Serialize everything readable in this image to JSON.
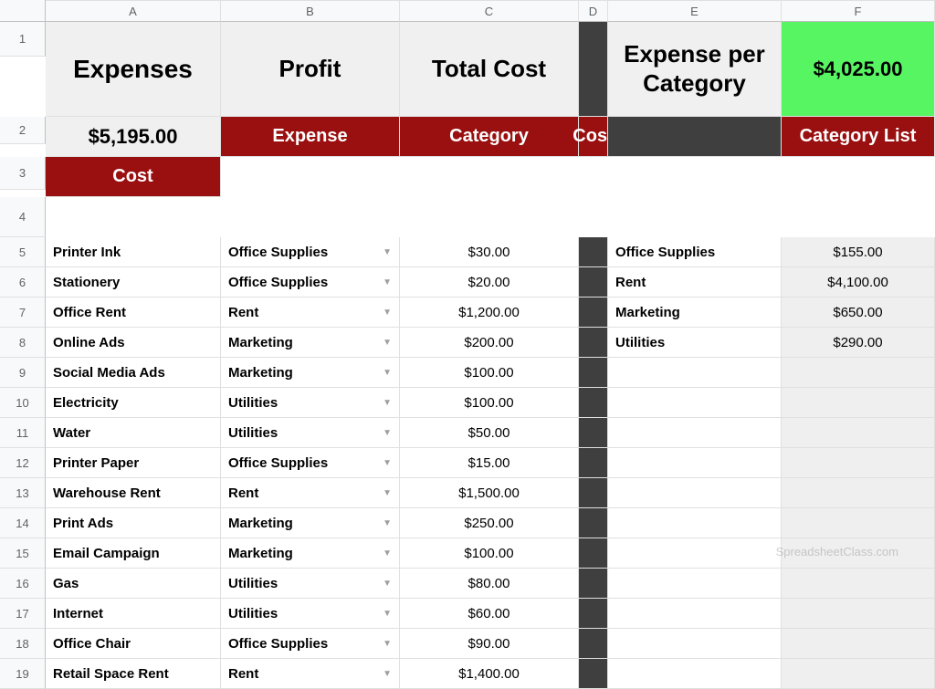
{
  "columns": [
    "A",
    "B",
    "C",
    "D",
    "E",
    "F"
  ],
  "titles": {
    "expenses": "Expenses",
    "profit": "Profit",
    "totalCost": "Total Cost",
    "expensePerCategory": "Expense per Category"
  },
  "summary": {
    "profitValue": "$4,025.00",
    "totalCostValue": "$5,195.00"
  },
  "headers": {
    "expense": "Expense",
    "category": "Category",
    "cost": "Cost",
    "categoryList": "Category List",
    "cost2": "Cost"
  },
  "rows": [
    {
      "n": "5",
      "expense": "Printer Ink",
      "category": "Office Supplies",
      "cost": "$30.00",
      "catList": "Office Supplies",
      "catCost": "$155.00"
    },
    {
      "n": "6",
      "expense": "Stationery",
      "category": "Office Supplies",
      "cost": "$20.00",
      "catList": "Rent",
      "catCost": "$4,100.00"
    },
    {
      "n": "7",
      "expense": "Office Rent",
      "category": "Rent",
      "cost": "$1,200.00",
      "catList": "Marketing",
      "catCost": "$650.00"
    },
    {
      "n": "8",
      "expense": "Online Ads",
      "category": "Marketing",
      "cost": "$200.00",
      "catList": "Utilities",
      "catCost": "$290.00"
    },
    {
      "n": "9",
      "expense": "Social Media Ads",
      "category": "Marketing",
      "cost": "$100.00",
      "catList": "",
      "catCost": ""
    },
    {
      "n": "10",
      "expense": "Electricity",
      "category": "Utilities",
      "cost": "$100.00",
      "catList": "",
      "catCost": ""
    },
    {
      "n": "11",
      "expense": "Water",
      "category": "Utilities",
      "cost": "$50.00",
      "catList": "",
      "catCost": ""
    },
    {
      "n": "12",
      "expense": "Printer Paper",
      "category": "Office Supplies",
      "cost": "$15.00",
      "catList": "",
      "catCost": ""
    },
    {
      "n": "13",
      "expense": "Warehouse Rent",
      "category": "Rent",
      "cost": "$1,500.00",
      "catList": "",
      "catCost": ""
    },
    {
      "n": "14",
      "expense": "Print Ads",
      "category": "Marketing",
      "cost": "$250.00",
      "catList": "",
      "catCost": ""
    },
    {
      "n": "15",
      "expense": "Email Campaign",
      "category": "Marketing",
      "cost": "$100.00",
      "catList": "",
      "catCost": ""
    },
    {
      "n": "16",
      "expense": "Gas",
      "category": "Utilities",
      "cost": "$80.00",
      "catList": "",
      "catCost": ""
    },
    {
      "n": "17",
      "expense": "Internet",
      "category": "Utilities",
      "cost": "$60.00",
      "catList": "",
      "catCost": ""
    },
    {
      "n": "18",
      "expense": "Office Chair",
      "category": "Office Supplies",
      "cost": "$90.00",
      "catList": "",
      "catCost": ""
    },
    {
      "n": "19",
      "expense": "Retail Space Rent",
      "category": "Rent",
      "cost": "$1,400.00",
      "catList": "",
      "catCost": ""
    }
  ],
  "watermark": "SpreadsheetClass.com"
}
